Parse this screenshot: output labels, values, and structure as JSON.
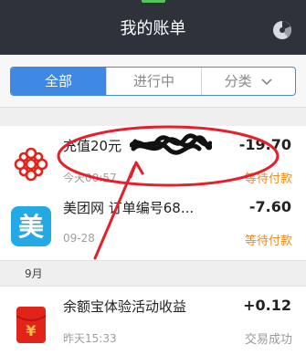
{
  "header": {
    "title": "我的账单",
    "chart_icon": "pie-chart-icon"
  },
  "tabs": [
    {
      "label": "全部",
      "active": true
    },
    {
      "label": "进行中",
      "active": false
    },
    {
      "label": "分类",
      "active": false
    }
  ],
  "bills": [
    {
      "icon": "china-unicom-logo-icon",
      "name": "充值20元",
      "amount": "-19.70",
      "date": "今天00:57",
      "status": "等待付款"
    },
    {
      "icon": "meituan-logo-icon",
      "name": "美团网 订单编号68...",
      "amount": "-7.60",
      "date": "09-28",
      "status": "等待付款"
    },
    {
      "icon": "red-envelope-icon",
      "name": "余额宝体验活动收益",
      "amount": "+0.12",
      "date": "昨天15:33",
      "status": "交易成功"
    }
  ],
  "section": {
    "label": "9月"
  },
  "colors": {
    "header_bg": "#2e323b",
    "accent": "#3f88e3",
    "pending": "#ef8b1f",
    "annotation": "#e5202b"
  }
}
